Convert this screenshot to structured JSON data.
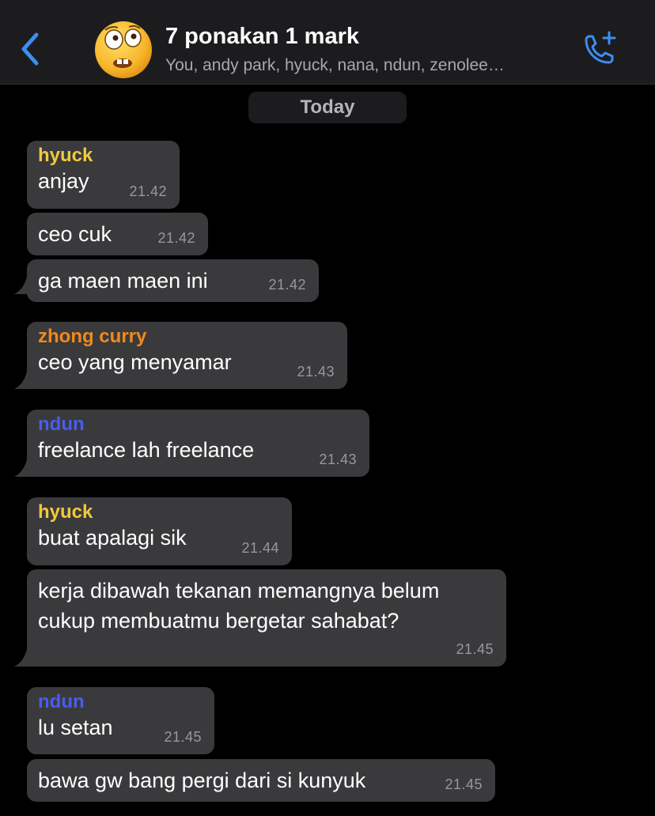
{
  "header": {
    "title": "7 ponakan 1 mark",
    "subtitle": "You, andy park, hyuck, nana, ndun, zenolee…",
    "back_icon": "chevron-left-icon",
    "call_icon": "phone-plus-icon",
    "accent_color": "#3d8ef0"
  },
  "date_divider": "Today",
  "messages": [
    {
      "sender": "hyuck",
      "sender_color": "#f0c93b",
      "text": "anjay",
      "time": "21.42"
    },
    {
      "sender": "",
      "text": "ceo cuk",
      "time": "21.42"
    },
    {
      "sender": "",
      "text": "ga maen maen ini",
      "time": "21.42"
    },
    {
      "sender": "zhong curry",
      "sender_color": "#f08a1c",
      "text": "ceo yang menyamar",
      "time": "21.43"
    },
    {
      "sender": "ndun",
      "sender_color": "#4a5cf0",
      "text": "freelance lah freelance",
      "time": "21.43"
    },
    {
      "sender": "hyuck",
      "sender_color": "#f0c93b",
      "text": "buat apalagi sik",
      "time": "21.44"
    },
    {
      "sender": "",
      "text_line1": "kerja dibawah tekanan memangnya belum",
      "text_line2": "cukup membuatmu bergetar sahabat?",
      "time": "21.45"
    },
    {
      "sender": "ndun",
      "sender_color": "#4a5cf0",
      "text": "lu setan",
      "time": "21.45"
    },
    {
      "sender": "",
      "text": "bawa gw bang pergi dari si kunyuk",
      "time": "21.45"
    }
  ]
}
